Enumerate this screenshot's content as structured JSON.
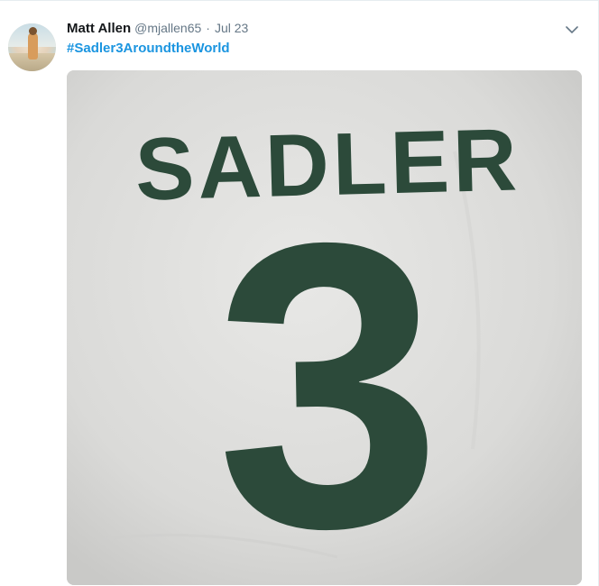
{
  "tweet": {
    "author_name": "Matt Allen",
    "author_handle": "@mjallen65",
    "separator": "·",
    "date": "Jul 23",
    "hashtag": "#Sadler3AroundtheWorld"
  },
  "media": {
    "jersey_name": "SADLER",
    "jersey_number": "3",
    "jersey_color": "#e0e0de",
    "lettering_color": "#2c4a3a"
  },
  "icons": {
    "avatar": "profile-photo",
    "menu": "chevron-down-icon"
  },
  "colors": {
    "link": "#1b95e0",
    "secondary_text": "#657786",
    "primary_text": "#14171a"
  }
}
